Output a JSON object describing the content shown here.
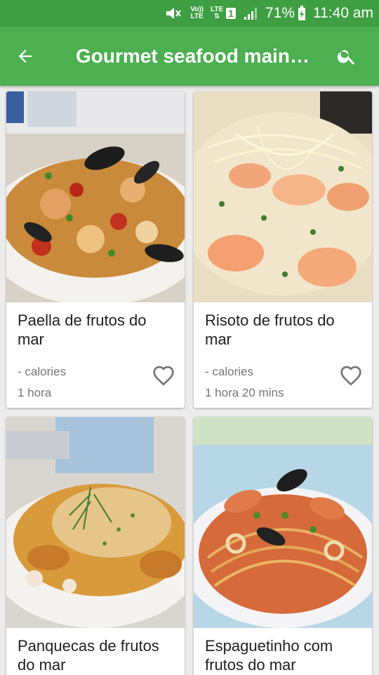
{
  "status_bar": {
    "volte_line1": "Vo))",
    "volte_line2": "LTE",
    "lte_label": "LTE",
    "sim_number": "1",
    "battery_percent": "71%",
    "time": "11:40 am"
  },
  "app_bar": {
    "title": "Gourmet seafood main…",
    "back_icon": "arrow-back-icon",
    "search_icon": "search-icon"
  },
  "colors": {
    "status_bar": "#3e9e42",
    "app_bar": "#4caf50",
    "background": "#ececec"
  },
  "recipes": [
    {
      "name": "Paella de frutos do mar",
      "calories": "- calories",
      "time": "1 hora"
    },
    {
      "name": "Risoto de frutos do mar",
      "calories": "- calories",
      "time": "1 hora 20 mins"
    },
    {
      "name": "Panquecas de frutos do mar",
      "calories": "",
      "time": ""
    },
    {
      "name": "Espaguetinho com frutos do mar",
      "calories": "",
      "time": ""
    }
  ]
}
